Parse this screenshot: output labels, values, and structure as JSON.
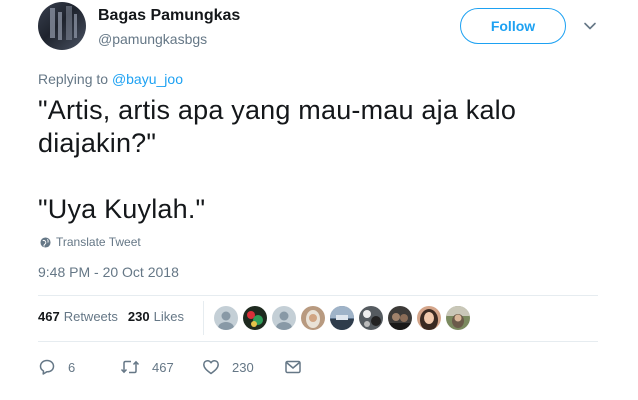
{
  "author": {
    "name": "Bagas Pamungkas",
    "handle": "@pamungkasbgs",
    "avatar_icon": "profile-avatar"
  },
  "follow_button": {
    "label": "Follow"
  },
  "menu": {
    "icon": "chevron-down-icon"
  },
  "reply": {
    "prefix": "Replying to ",
    "mention": "@bayu_joo"
  },
  "tweet": {
    "lines": [
      "\"Artis, artis apa yang mau-mau aja kalo",
      "diajakin?\"",
      "\"Uya Kuylah.\""
    ]
  },
  "translate": {
    "label": "Translate Tweet",
    "icon": "globe-icon"
  },
  "timestamp": "9:48 PM - 20 Oct 2018",
  "stats": {
    "retweets_count": "467",
    "retweets_label": "Retweets",
    "likes_count": "230",
    "likes_label": "Likes"
  },
  "likers": [
    {
      "kind": "default-avatar",
      "bg": "#c4cfd6"
    },
    {
      "kind": "green-flowers",
      "bg": "#1e2a1f"
    },
    {
      "kind": "default-avatar",
      "bg": "#c4cfd6"
    },
    {
      "kind": "person-hijab",
      "bg": "#b89a80"
    },
    {
      "kind": "landscape-blue",
      "bg": "#59708a"
    },
    {
      "kind": "pattern-bw",
      "bg": "#555b60"
    },
    {
      "kind": "group-dark",
      "bg": "#3c3a38"
    },
    {
      "kind": "person-long-hair",
      "bg": "#d4a58a"
    },
    {
      "kind": "person-outdoor",
      "bg": "#7b8a5f"
    }
  ],
  "actions": {
    "reply_count": "6",
    "retweet_count": "467",
    "like_count": "230",
    "reply_icon": "reply-icon",
    "retweet_icon": "retweet-icon",
    "like_icon": "heart-icon",
    "message_icon": "envelope-icon"
  },
  "colors": {
    "accent": "#1da1f2",
    "text": "#14171a",
    "secondary": "#657786",
    "divider": "#e6ecf0"
  }
}
